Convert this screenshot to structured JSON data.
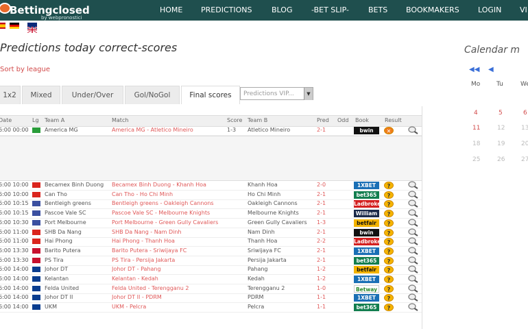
{
  "header": {
    "logo_text": "Bettingclosed",
    "logo_sub": "by webpronostici",
    "nav": [
      "HOME",
      "PREDICTIONS",
      "BLOG",
      "-BET SLIP-",
      "BETS",
      "BOOKMAKERS",
      "LOGIN",
      "VI"
    ]
  },
  "page": {
    "title": "Predictions today correct-scores",
    "sort_link": "Sort by league",
    "calendar_title": "Calendar m"
  },
  "tabs": [
    "1x2",
    "Mixed",
    "Under/Over",
    "Gol/NoGol",
    "Final scores"
  ],
  "vip_select": "Predictions VIP...",
  "vip_arrow": "▼",
  "columns": [
    "Date",
    "Lg",
    "Team A",
    "Match",
    "Score",
    "Team B",
    "Pred",
    "Odd",
    "Book",
    "Result"
  ],
  "first_row": {
    "date": "6:00 00:00",
    "team_a": "America MG",
    "match": "America MG - Atletico Mineiro",
    "score": "1-3",
    "team_b": "Atletico Mineiro",
    "pred": "2-1",
    "book": "bwin",
    "result": "✕"
  },
  "rows": [
    {
      "date": "6:00 10:00",
      "team_a": "Becamex Binh Duong",
      "match": "Becamex Binh Duong - Khanh Hoa",
      "team_b": "Khanh Hoa",
      "pred": "2-0",
      "book": "1XBET",
      "book_color": "#1a6fb5"
    },
    {
      "date": "6:00 10:00",
      "team_a": "Can Tho",
      "match": "Can Tho - Ho Chi Minh",
      "team_b": "Ho Chi Minh",
      "pred": "2-1",
      "book": "bet365",
      "book_color": "#127e4f"
    },
    {
      "date": "6:00 10:15",
      "team_a": "Bentleigh greens",
      "match": "Bentleigh greens - Oakleigh Cannons",
      "team_b": "Oakleigh Cannons",
      "pred": "2-1",
      "book": "Ladbrokes",
      "book_color": "#d41f1f"
    },
    {
      "date": "6:00 10:15",
      "team_a": "Pascoe Vale SC",
      "match": "Pascoe Vale SC - Melbourne Knights",
      "team_b": "Melbourne Knights",
      "pred": "2-1",
      "book": "William Hill",
      "book_color": "#1b2a4a"
    },
    {
      "date": "6:00 10:30",
      "team_a": "Port Melbourne",
      "match": "Port Melbourne - Green Gully Cavaliers",
      "team_b": "Green Gully Cavaliers",
      "pred": "1-3",
      "book": "betfair",
      "book_color": "#f4b400"
    },
    {
      "date": "6:00 11:00",
      "team_a": "SHB Da Nang",
      "match": "SHB Da Nang - Nam Dinh",
      "team_b": "Nam Dinh",
      "pred": "2-1",
      "book": "bwin",
      "book_color": "#111"
    },
    {
      "date": "6:00 11:00",
      "team_a": "Hai Phong",
      "match": "Hai Phong - Thanh Hoa",
      "team_b": "Thanh Hoa",
      "pred": "2-2",
      "book": "Ladbrokes",
      "book_color": "#d41f1f"
    },
    {
      "date": "6:00 13:30",
      "team_a": "Barito Putera",
      "match": "Barito Putera - Sriwijaya FC",
      "team_b": "Sriwijaya FC",
      "pred": "2-1",
      "book": "1XBET",
      "book_color": "#1a6fb5"
    },
    {
      "date": "6:00 13:30",
      "team_a": "PS Tira",
      "match": "PS Tira - Persija Jakarta",
      "team_b": "Persija Jakarta",
      "pred": "2-1",
      "book": "bet365",
      "book_color": "#127e4f"
    },
    {
      "date": "6:00 14:00",
      "team_a": "Johor DT",
      "match": "Johor DT - Pahang",
      "team_b": "Pahang",
      "pred": "1-2",
      "book": "betfair",
      "book_color": "#f4b400"
    },
    {
      "date": "6:00 14:00",
      "team_a": "Kelantan",
      "match": "Kelantan - Kedah",
      "team_b": "Kedah",
      "pred": "1-2",
      "book": "1XBET",
      "book_color": "#1a6fb5"
    },
    {
      "date": "6:00 14:00",
      "team_a": "Felda United",
      "match": "Felda United - Terengganu 2",
      "team_b": "Terengganu 2",
      "pred": "1-0",
      "book": "Betway",
      "book_color": "#ffffff"
    },
    {
      "date": "6:00 14:00",
      "team_a": "Johor DT II",
      "match": "Johor DT II - PDRM",
      "team_b": "PDRM",
      "pred": "1-1",
      "book": "1XBET",
      "book_color": "#1a6fb5"
    },
    {
      "date": "6:00 14:00",
      "team_a": "UKM",
      "match": "UKM - Pelcra",
      "team_b": "Pelcra",
      "pred": "1-1",
      "book": "bet365",
      "book_color": "#127e4f"
    }
  ],
  "calendar": {
    "nav": [
      "◀◀",
      "◀"
    ],
    "days": [
      "Mo",
      "Tu",
      "We"
    ],
    "numbers": [
      "4",
      "5",
      "6",
      "11",
      "12",
      "13",
      "18",
      "19",
      "20",
      "25",
      "26",
      "27"
    ]
  }
}
